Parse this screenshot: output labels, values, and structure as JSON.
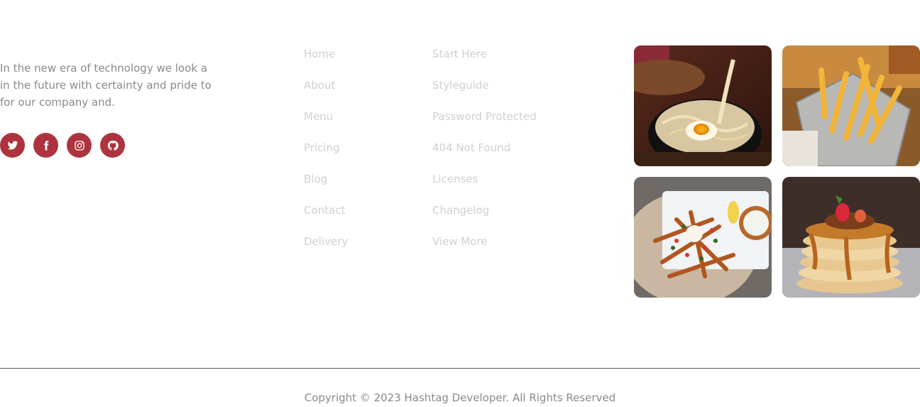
{
  "about": {
    "text": "In the new era of technology we look a in the future with certainty and pride to for our company and."
  },
  "social": [
    {
      "name": "twitter-icon"
    },
    {
      "name": "facebook-icon"
    },
    {
      "name": "instagram-icon"
    },
    {
      "name": "github-icon"
    }
  ],
  "links_col1": [
    "Home",
    "About",
    "Menu",
    "Pricing",
    "Blog",
    "Contact",
    "Delivery"
  ],
  "links_col2": [
    "Start Here",
    "Styleguide",
    "Password Protected",
    "404 Not Found",
    "Licenses",
    "Changelog",
    "View More"
  ],
  "gallery": [
    "egg-noodle-bowl",
    "french-fries",
    "loaded-fries",
    "pancake-stack"
  ],
  "colors": {
    "accent": "#ad343e",
    "text": "#8a8a86",
    "link": "#d0d0cc"
  },
  "footer": {
    "copyright": "Copyright © 2023 Hashtag Developer. All Rights Reserved"
  }
}
